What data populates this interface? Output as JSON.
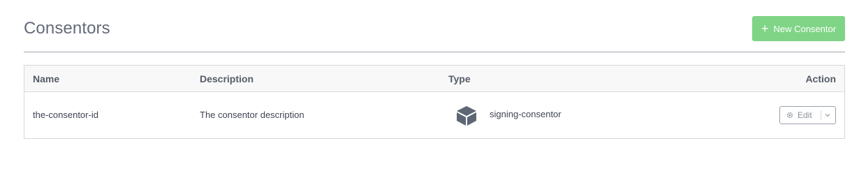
{
  "header": {
    "title": "Consentors",
    "new_button_label": "New Consentor",
    "new_button_icon": "plus-icon"
  },
  "table": {
    "columns": [
      "Name",
      "Description",
      "Type",
      "Action"
    ],
    "rows": [
      {
        "name": "the-consentor-id",
        "description": "The consentor description",
        "type": "signing-consentor",
        "type_icon": "cube-icon",
        "action_label": "Edit",
        "action_icon": "gear-icon"
      }
    ]
  },
  "colors": {
    "accent_green": "#7fd486",
    "text_dark": "#3f4552",
    "icon_slate": "#5d6675"
  }
}
